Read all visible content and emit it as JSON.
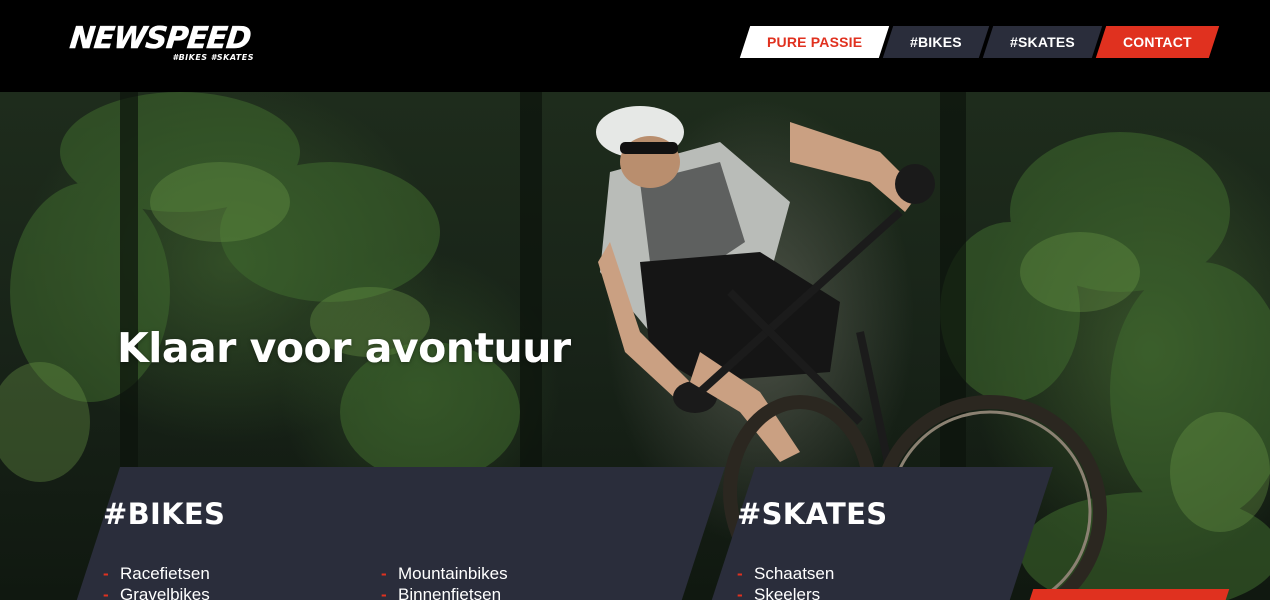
{
  "header": {
    "logo": {
      "name": "NEWSPEED",
      "tagline": "#BIKES #SKATES"
    },
    "nav": [
      {
        "label": "PURE PASSIE",
        "active": true
      },
      {
        "label": "#BIKES",
        "active": false
      },
      {
        "label": "#SKATES",
        "active": false
      },
      {
        "label": "CONTACT",
        "active": false
      }
    ]
  },
  "hero": {
    "title": "Klaar voor avontuur"
  },
  "bikes": {
    "title": "#BIKES",
    "column1": [
      "Racefietsen",
      "Gravelbikes"
    ],
    "column2": [
      "Mountainbikes",
      "Binnenfietsen"
    ]
  },
  "skates": {
    "title": "#SKATES",
    "column1": [
      "Schaatsen",
      "Skeelers"
    ]
  },
  "colors": {
    "accent": "#e0311f",
    "panel": "#2a2d3b",
    "header": "#000000"
  }
}
